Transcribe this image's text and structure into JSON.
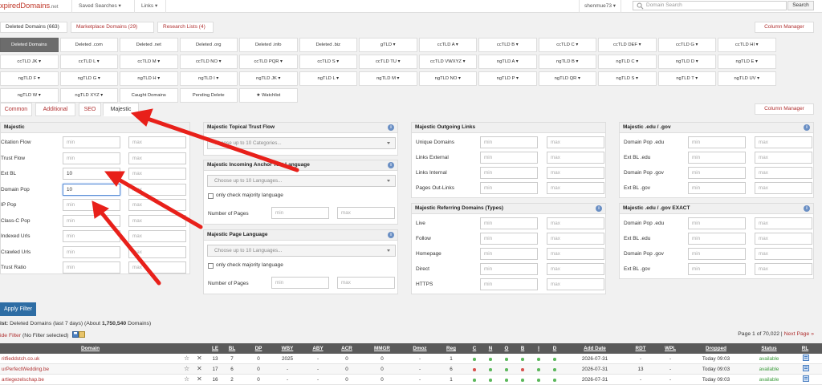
{
  "topbar": {
    "logo_main": "xpiredDomains",
    "logo_tld": ".net",
    "nav_saved": "Saved Searches ▾",
    "nav_links": "Links ▾",
    "user": "shenmue73 ▾",
    "search_placeholder": "Domain Search",
    "search_button": "Search"
  },
  "main_tabs": {
    "deleted": "Deleted Domains (663)",
    "marketplace": "Marketplace Domains (29)",
    "research": "Research Lists (4)",
    "column_manager": "Column Manager"
  },
  "filter_rows": [
    [
      "Deleted Domains",
      "Deleted .com",
      "Deleted .net",
      "Deleted .org",
      "Deleted .info",
      "Deleted .biz",
      "gTLD ▾",
      "ccTLD A ▾",
      "ccTLD B ▾",
      "ccTLD C ▾",
      "ccTLD DEF ▾",
      "ccTLD G ▾",
      "ccTLD HI ▾"
    ],
    [
      "ccTLD JK ▾",
      "ccTLD L ▾",
      "ccTLD M ▾",
      "ccTLD NO ▾",
      "ccTLD PQR ▾",
      "ccTLD S ▾",
      "ccTLD TU ▾",
      "ccTLD VWXYZ ▾",
      "ngTLD A ▾",
      "ngTLD B ▾",
      "ngTLD C ▾",
      "ngTLD D ▾",
      "ngTLD E ▾"
    ],
    [
      "ngTLD F ▾",
      "ngTLD G ▾",
      "ngTLD H ▾",
      "ngTLD I ▾",
      "ngTLD JK ▾",
      "ngTLD L ▾",
      "ngTLD M ▾",
      "ngTLD NO ▾",
      "ngTLD P ▾",
      "ngTLD QR ▾",
      "ngTLD S ▾",
      "ngTLD T ▾",
      "ngTLD UV ▾"
    ],
    [
      "ngTLD W ▾",
      "ngTLD XYZ ▾",
      "Caught Domains",
      "Pending Delete",
      "★ Watchlist"
    ]
  ],
  "sub_tabs": {
    "common": "Common",
    "additional": "Additional",
    "seo": "SEO",
    "majestic": "Majestic",
    "column_manager": "Column Manager"
  },
  "majestic_panel": {
    "title": "Majestic",
    "rows": [
      {
        "label": "Citation Flow",
        "min": "",
        "max": ""
      },
      {
        "label": "Trust Flow",
        "min": "",
        "max": ""
      },
      {
        "label": "Ext BL",
        "min": "10",
        "max": ""
      },
      {
        "label": "Domain Pop",
        "min": "10",
        "max": ""
      },
      {
        "label": "IP Pop",
        "min": "",
        "max": ""
      },
      {
        "label": "Class-C Pop",
        "min": "",
        "max": ""
      },
      {
        "label": "Indexed Urls",
        "min": "",
        "max": ""
      },
      {
        "label": "Crawled Urls",
        "min": "",
        "max": ""
      },
      {
        "label": "Trust Ratio",
        "min": "",
        "max": ""
      }
    ]
  },
  "placeholders": {
    "min": "min",
    "max": "max"
  },
  "topical_panel": {
    "title": "Majestic Topical Trust Flow",
    "select": "Choose up to 10 Categories..."
  },
  "anchor_panel": {
    "title": "Majestic Incoming Anchor Text Language",
    "select": "Choose up to 10 Languages...",
    "checkbox": "only check majority language",
    "pages_label": "Number of Pages"
  },
  "page_lang_panel": {
    "title": "Majestic Page Language",
    "select": "Choose up to 10 Languages...",
    "checkbox": "only check majority language",
    "pages_label": "Number of Pages"
  },
  "outgoing_panel": {
    "title": "Majestic Outgoing Links",
    "rows": [
      "Unique Domains",
      "Links External",
      "Links Internal",
      "Pages Out-Links"
    ]
  },
  "referring_panel": {
    "title": "Majestic Referring Domains (Types)",
    "rows": [
      "Live",
      "Follow",
      "Homepage",
      "Direct",
      "HTTPS"
    ]
  },
  "edu_panel": {
    "title": "Majestic .edu / .gov",
    "rows": [
      "Domain Pop .edu",
      "Ext BL .edu",
      "Domain Pop .gov",
      "Ext BL .gov"
    ]
  },
  "edu_exact_panel": {
    "title": "Majestic .edu / .gov EXACT",
    "rows": [
      "Domain Pop .edu",
      "Ext BL .edu",
      "Domain Pop .gov",
      "Ext BL .gov"
    ]
  },
  "apply_button": "Apply Filter",
  "list_info": {
    "prefix": "ist:",
    "text": " Deleted Domains (last 7 days) (About ",
    "count": "1,750,540",
    "suffix": " Domains)"
  },
  "hide_filter": {
    "link": "ide Filter",
    "text": " (No Filter selected)"
  },
  "pager": {
    "text": "Page 1 of 70,022 | ",
    "next": "Next Page »"
  },
  "table": {
    "headers": [
      "Domain",
      "LE",
      "BL",
      "DP",
      "WBY",
      "ABY",
      "ACR",
      "MMGR",
      "Dmoz",
      "Reg",
      "C",
      "N",
      "O",
      "B",
      "I",
      "D",
      "Add Date",
      "RDT",
      "WPL",
      "Dropped",
      "Status",
      "RL"
    ],
    "rows": [
      {
        "domain": "ritfieddstch.co.uk",
        "le": "13",
        "bl": "7",
        "dp": "0",
        "wby": "2025",
        "aby": "-",
        "acr": "0",
        "mmgr": "0",
        "dmoz": "-",
        "reg": "1",
        "dots": [
          "green",
          "green",
          "green",
          "green",
          "green",
          "green"
        ],
        "add_date": "2026-07-31",
        "rdt": "-",
        "wpl": "-",
        "dropped": "Today 09:03",
        "status": "available"
      },
      {
        "domain": "urPerfectWedding.be",
        "le": "17",
        "bl": "6",
        "dp": "0",
        "wby": "-",
        "aby": "-",
        "acr": "0",
        "mmgr": "0",
        "dmoz": "-",
        "reg": "6",
        "dots": [
          "red",
          "green",
          "green",
          "red",
          "green",
          "green"
        ],
        "add_date": "2026-07-31",
        "rdt": "13",
        "wpl": "-",
        "dropped": "Today 09:03",
        "status": "available"
      },
      {
        "domain": "artiegezelschap.be",
        "le": "16",
        "bl": "2",
        "dp": "0",
        "wby": "-",
        "aby": "-",
        "acr": "0",
        "mmgr": "0",
        "dmoz": "-",
        "reg": "1",
        "dots": [
          "green",
          "green",
          "green",
          "green",
          "green",
          "green"
        ],
        "add_date": "2026-07-31",
        "rdt": "-",
        "wpl": "-",
        "dropped": "Today 09:03",
        "status": "available"
      }
    ]
  },
  "colors": {
    "accent_red": "#b03030",
    "header_gray": "#5a5a5a",
    "apply_blue": "#2e6da4",
    "arrow_red": "#e8201a",
    "dot_green": "#5cb85c",
    "dot_red": "#d9534f"
  }
}
